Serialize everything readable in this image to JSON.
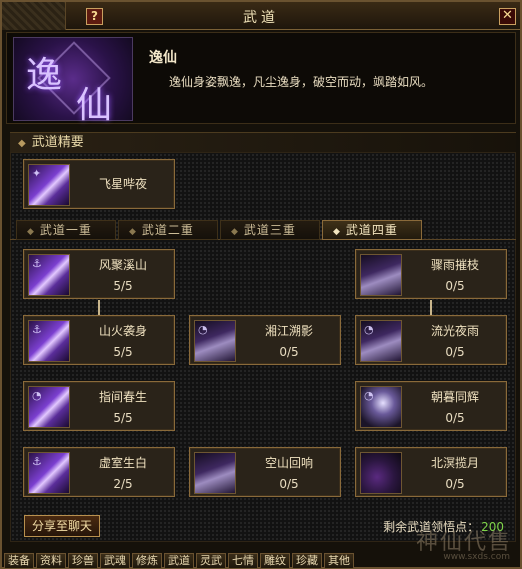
{
  "window": {
    "title": "武道",
    "help_label": "?",
    "close_label": "✕"
  },
  "header": {
    "emblem_chars": [
      "逸",
      "仙"
    ],
    "name": "逸仙",
    "description": "逸仙身姿飘逸，凡尘逸身，破空而动，飒踏如风。"
  },
  "essence": {
    "section_title": "武道精要",
    "skill": {
      "name": "飞星哔夜",
      "icon": "shooting-star-icon"
    }
  },
  "tabs": [
    {
      "label": "武道一重",
      "active": false
    },
    {
      "label": "武道二重",
      "active": false
    },
    {
      "label": "武道三重",
      "active": false
    },
    {
      "label": "武道四重",
      "active": true
    }
  ],
  "skills": [
    {
      "name": "风聚溪山",
      "level": "5/5",
      "icon": "purple"
    },
    {
      "name": "骤雨摧枝",
      "level": "0/5",
      "icon": "dark"
    },
    {
      "name": "山火袭身",
      "level": "5/5",
      "icon": "purple"
    },
    {
      "name": "湘江溯影",
      "level": "0/5",
      "icon": "dark"
    },
    {
      "name": "流光夜雨",
      "level": "0/5",
      "icon": "dark"
    },
    {
      "name": "指间春生",
      "level": "5/5",
      "icon": "purple"
    },
    {
      "name": "朝暮同辉",
      "level": "0/5",
      "icon": "pale"
    },
    {
      "name": "虚室生白",
      "level": "2/5",
      "icon": "purple"
    },
    {
      "name": "空山回响",
      "level": "0/5",
      "icon": "dark"
    },
    {
      "name": "北溟揽月",
      "level": "0/5",
      "icon": "orb"
    }
  ],
  "footer": {
    "share_label": "分享至聊天",
    "points_label": "剩余武道领悟点：",
    "points_value": "200"
  },
  "bottom_tabs": [
    "装备",
    "资料",
    "珍兽",
    "武魂",
    "修炼",
    "武道",
    "灵武",
    "七情",
    "雕纹",
    "珍藏",
    "其他"
  ],
  "watermark": {
    "text": "神仙代售",
    "url": "www.sxds.com"
  }
}
